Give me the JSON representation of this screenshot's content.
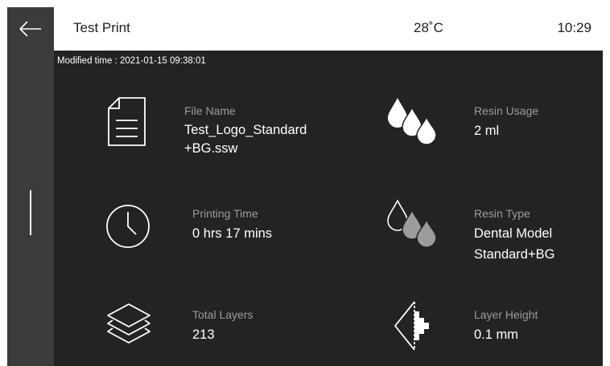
{
  "header": {
    "title": "Test Print",
    "temperature": "28˚C",
    "time": "10:29"
  },
  "modified": {
    "text": "Modified time : 2021-01-15 09:38:01"
  },
  "details": {
    "file_name": {
      "label": "File Name",
      "value_line1": "Test_Logo_Standard",
      "value_line2": "+BG.ssw",
      "icon": "document-icon"
    },
    "printing_time": {
      "label": "Printing Time",
      "value": "0 hrs 17 mins",
      "icon": "clock-icon"
    },
    "total_layers": {
      "label": "Total Layers",
      "value": "213",
      "icon": "layers-icon"
    },
    "resin_usage": {
      "label": "Resin Usage",
      "value": "2 ml",
      "icon": "drops-filled-icon"
    },
    "resin_type": {
      "label": "Resin Type",
      "value_line1": "Dental Model",
      "value_line2": "Standard+BG",
      "icon": "drops-outline-icon"
    },
    "layer_height": {
      "label": "Layer Height",
      "value": "0.1 mm",
      "icon": "layer-height-icon"
    }
  },
  "colors": {
    "background": "#232323",
    "sidebar": "#3b3b3b",
    "header": "#ffffff",
    "label": "#9c9c9c",
    "value": "#ffffff"
  }
}
